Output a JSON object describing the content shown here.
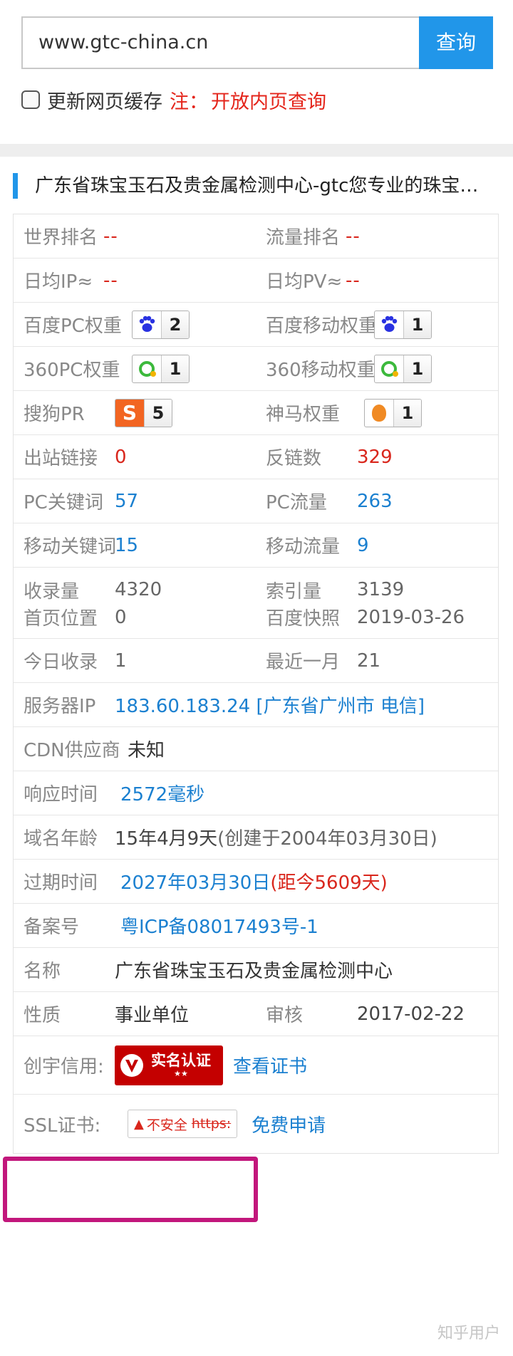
{
  "search": {
    "value": "www.gtc-china.cn",
    "button": "查询"
  },
  "refresh": {
    "label": "更新网页缓存",
    "note_label": "注：",
    "note_text": "开放内页查询"
  },
  "site_title": "广东省珠宝玉石及贵金属检测中心-gtc您专业的珠宝…",
  "stats": {
    "world_rank": {
      "label": "世界排名",
      "value": "--"
    },
    "traffic_rank": {
      "label": "流量排名",
      "value": "--"
    },
    "daily_ip": {
      "label": "日均IP≈",
      "value": "--"
    },
    "daily_pv": {
      "label": "日均PV≈",
      "value": "--"
    },
    "baidu_pc": {
      "label": "百度PC权重",
      "value": "2",
      "icon": "baidu-paw-icon"
    },
    "baidu_mobile": {
      "label": "百度移动权重",
      "value": "1",
      "icon": "baidu-paw-icon"
    },
    "so360_pc": {
      "label": "360PC权重",
      "value": "1",
      "icon": "360-ring-icon"
    },
    "so360_mobile": {
      "label": "360移动权重",
      "value": "1",
      "icon": "360-ring-icon"
    },
    "sogou_pr": {
      "label": "搜狗PR",
      "value": "5",
      "icon": "sogou-s-icon"
    },
    "shenma": {
      "label": "神马权重",
      "value": "1",
      "icon": "shenma-icon"
    },
    "outbound": {
      "label": "出站链接",
      "value": "0"
    },
    "backlinks": {
      "label": "反链数",
      "value": "329"
    },
    "pc_keywords": {
      "label": "PC关键词",
      "value": "57"
    },
    "pc_traffic": {
      "label": "PC流量",
      "value": "263"
    },
    "mobile_keywords": {
      "label": "移动关键词",
      "value": "15"
    },
    "mobile_traffic": {
      "label": "移动流量",
      "value": "9"
    },
    "indexed": {
      "label": "收录量",
      "value": "4320"
    },
    "index_count": {
      "label": "索引量",
      "value": "3139"
    },
    "home_position": {
      "label": "首页位置",
      "value": "0"
    },
    "baidu_snapshot": {
      "label": "百度快照",
      "value": "2019-03-26"
    },
    "today_indexed": {
      "label": "今日收录",
      "value": "1"
    },
    "last_month": {
      "label": "最近一月",
      "value": "21"
    }
  },
  "details": {
    "server_ip": {
      "label": "服务器IP",
      "value": "183.60.183.24 [广东省广州市 电信]"
    },
    "cdn": {
      "label": "CDN供应商",
      "value": "未知"
    },
    "response": {
      "label": "响应时间",
      "value": "2572毫秒"
    },
    "domain_age": {
      "label": "域名年龄",
      "value": "15年4月9天",
      "extra": "(创建于2004年03月30日)"
    },
    "expire": {
      "label": "过期时间",
      "value": "2027年03月30日",
      "extra": "(距今5609天)"
    },
    "icp": {
      "label": "备案号",
      "value": "粤ICP备08017493号-1"
    },
    "name": {
      "label": "名称",
      "value": "广东省珠宝玉石及贵金属检测中心"
    },
    "nature": {
      "label": "性质",
      "value": "事业单位"
    },
    "audit": {
      "label": "审核",
      "value": "2017-02-22"
    },
    "credit": {
      "label": "创宇信用:",
      "stamp_text": "实名认证",
      "stamp_stars": "★★",
      "link": "查看证书"
    },
    "ssl": {
      "label": "SSL证书:",
      "badge_text": "不安全",
      "badge_https": "https:",
      "link": "免费申请"
    }
  },
  "watermark": "知乎用户",
  "colors": {
    "accent": "#2196e9",
    "red": "#d9261c",
    "blue_text": "#1b80d0",
    "highlight": "#c2177c"
  }
}
